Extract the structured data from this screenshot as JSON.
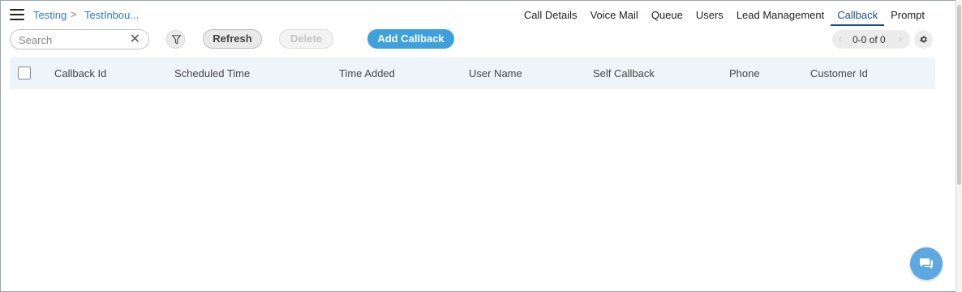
{
  "breadcrumb": {
    "items": [
      "Testing",
      "TestInbou..."
    ],
    "separator": ">"
  },
  "tabs": [
    {
      "label": "Call Details",
      "active": false
    },
    {
      "label": "Voice Mail",
      "active": false
    },
    {
      "label": "Queue",
      "active": false
    },
    {
      "label": "Users",
      "active": false
    },
    {
      "label": "Lead Management",
      "active": false
    },
    {
      "label": "Callback",
      "active": true
    },
    {
      "label": "Prompt",
      "active": false
    }
  ],
  "toolbar": {
    "search_placeholder": "Search",
    "search_value": "",
    "refresh_label": "Refresh",
    "delete_label": "Delete",
    "add_label": "Add Callback"
  },
  "pager": {
    "text": "0-0 of 0"
  },
  "table": {
    "columns": [
      "Callback Id",
      "Scheduled Time",
      "Time Added",
      "User Name",
      "Self Callback",
      "Phone",
      "Customer Id"
    ],
    "rows": []
  },
  "colors": {
    "accent": "#3ea0dd",
    "active_tab": "#1c4e8c",
    "link": "#2f7bbf",
    "header_bg": "#eef5fa"
  },
  "icons": [
    "menu-icon",
    "chevron-right-icon",
    "close-icon",
    "filter-icon",
    "chevron-left-icon",
    "chevron-right-icon",
    "gear-icon",
    "chat-icon"
  ]
}
